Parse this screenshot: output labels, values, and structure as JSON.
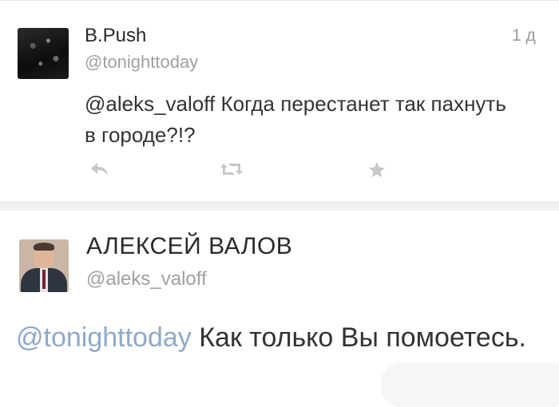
{
  "tweet1": {
    "author_name": "B.Push",
    "handle": "@tonighttoday",
    "time": "1 д",
    "mention": "@aleks_valoff",
    "text": " Когда перестанет так пахнуть в городе?!?",
    "icons": {
      "reply": "reply-icon",
      "retweet": "retweet-icon",
      "favorite": "star-icon"
    }
  },
  "tweet2": {
    "author_name": "АЛЕКСЕЙ ВАЛОВ",
    "handle": "@aleks_valoff",
    "mention": "@tonighttoday",
    "text": " Как только Вы помоетесь."
  },
  "colors": {
    "mention": "#8fa9c9",
    "handle": "#a0a0a0",
    "text": "#333333",
    "icon": "#c7c7c7"
  }
}
